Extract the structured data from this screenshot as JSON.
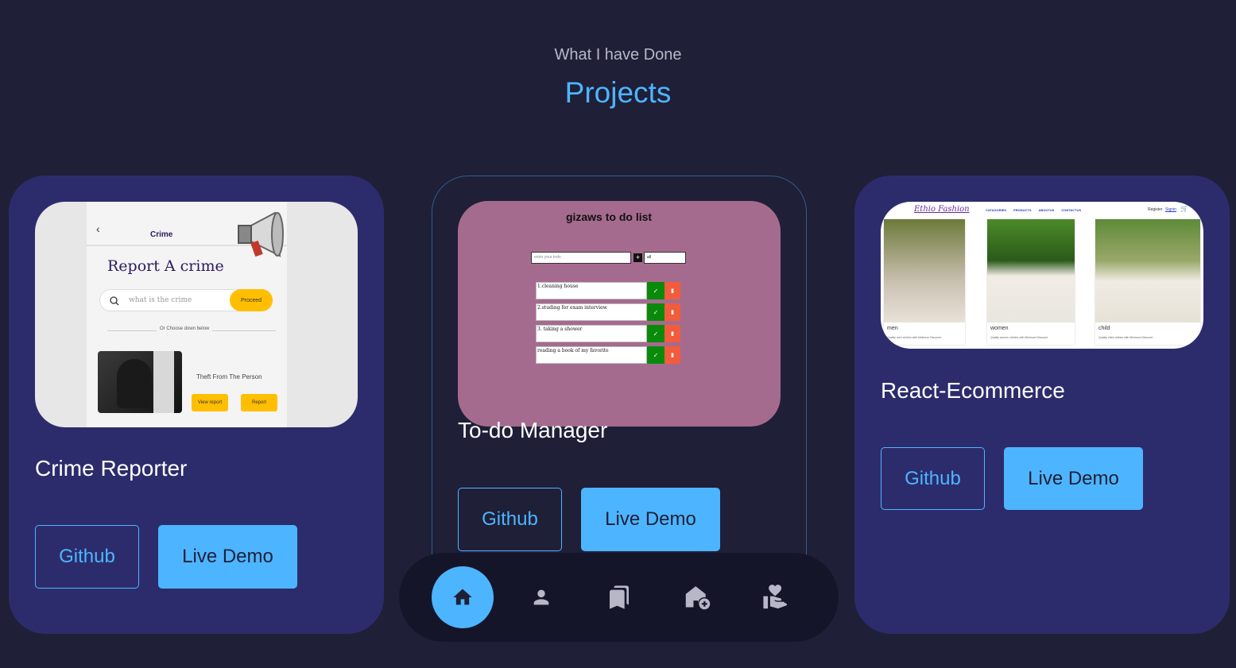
{
  "header": {
    "subtitle": "What I have Done",
    "title": "Projects"
  },
  "projects": [
    {
      "title": "Crime Reporter",
      "github_label": "Github",
      "demo_label": "Live Demo",
      "preview": {
        "header": "Crime",
        "heading": "Report A crime",
        "search_placeholder": "what is the crime",
        "proceed_label": "Proceed",
        "divider_text": "Or Choose down below",
        "card_text": "Theft From The Person",
        "view_report_label": "View report",
        "report_label": "Report"
      }
    },
    {
      "title": "To-do Manager",
      "github_label": "Github",
      "demo_label": "Live Demo",
      "preview": {
        "heading": "gizaws to do list",
        "input_placeholder": "enter your todo",
        "filter_value": "all",
        "todos": [
          "1.cleaning house",
          "2.studing for exam interview",
          "3. taking a shower",
          "reading a book of my favorite"
        ]
      }
    },
    {
      "title": "React-Ecommerce",
      "github_label": "Github",
      "demo_label": "Live Demo",
      "preview": {
        "brand": "Ethio Fashion",
        "nav": [
          "CATAGORIES",
          "PRODUCTS",
          "ABOUTUS",
          "CONTACTUS"
        ],
        "register": "Register",
        "signin": "Signin",
        "items": [
          {
            "label": "men",
            "desc": "Quality men clothes with Minimum Discount"
          },
          {
            "label": "women",
            "desc": "Quality women clothes with Minimum Discount"
          },
          {
            "label": "child",
            "desc": "Quality child clothes with Minimum Discount"
          }
        ]
      }
    }
  ],
  "nav": [
    "home-icon",
    "user-icon",
    "bookmarks-icon",
    "add-home-icon",
    "volunteer-icon"
  ],
  "colors": {
    "accent": "#4db5ff",
    "background": "#1f1f38",
    "card": "#2c2c6c"
  }
}
